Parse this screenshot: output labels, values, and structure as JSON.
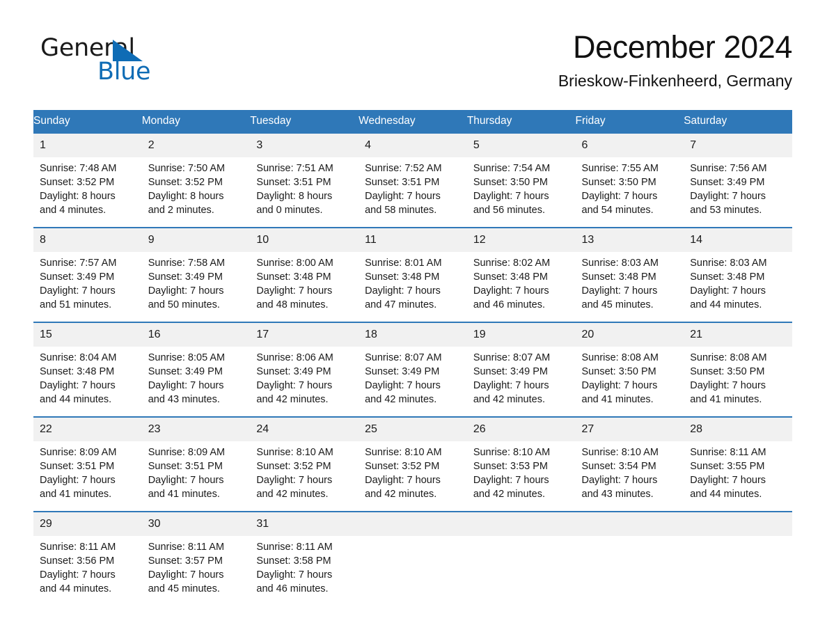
{
  "brand": {
    "word_one": "General",
    "word_two": "Blue",
    "triangle_color": "#0f6cb5"
  },
  "header": {
    "month_title": "December 2024",
    "location": "Brieskow-Finkenheerd, Germany",
    "header_color": "#2f78b8"
  },
  "calendar": {
    "weekday_headers": [
      "Sunday",
      "Monday",
      "Tuesday",
      "Wednesday",
      "Thursday",
      "Friday",
      "Saturday"
    ],
    "weeks": [
      {
        "days": [
          {
            "number": "1",
            "sunrise": "Sunrise: 7:48 AM",
            "sunset": "Sunset: 3:52 PM",
            "daylight_line1": "Daylight: 8 hours",
            "daylight_line2": "and 4 minutes."
          },
          {
            "number": "2",
            "sunrise": "Sunrise: 7:50 AM",
            "sunset": "Sunset: 3:52 PM",
            "daylight_line1": "Daylight: 8 hours",
            "daylight_line2": "and 2 minutes."
          },
          {
            "number": "3",
            "sunrise": "Sunrise: 7:51 AM",
            "sunset": "Sunset: 3:51 PM",
            "daylight_line1": "Daylight: 8 hours",
            "daylight_line2": "and 0 minutes."
          },
          {
            "number": "4",
            "sunrise": "Sunrise: 7:52 AM",
            "sunset": "Sunset: 3:51 PM",
            "daylight_line1": "Daylight: 7 hours",
            "daylight_line2": "and 58 minutes."
          },
          {
            "number": "5",
            "sunrise": "Sunrise: 7:54 AM",
            "sunset": "Sunset: 3:50 PM",
            "daylight_line1": "Daylight: 7 hours",
            "daylight_line2": "and 56 minutes."
          },
          {
            "number": "6",
            "sunrise": "Sunrise: 7:55 AM",
            "sunset": "Sunset: 3:50 PM",
            "daylight_line1": "Daylight: 7 hours",
            "daylight_line2": "and 54 minutes."
          },
          {
            "number": "7",
            "sunrise": "Sunrise: 7:56 AM",
            "sunset": "Sunset: 3:49 PM",
            "daylight_line1": "Daylight: 7 hours",
            "daylight_line2": "and 53 minutes."
          }
        ]
      },
      {
        "days": [
          {
            "number": "8",
            "sunrise": "Sunrise: 7:57 AM",
            "sunset": "Sunset: 3:49 PM",
            "daylight_line1": "Daylight: 7 hours",
            "daylight_line2": "and 51 minutes."
          },
          {
            "number": "9",
            "sunrise": "Sunrise: 7:58 AM",
            "sunset": "Sunset: 3:49 PM",
            "daylight_line1": "Daylight: 7 hours",
            "daylight_line2": "and 50 minutes."
          },
          {
            "number": "10",
            "sunrise": "Sunrise: 8:00 AM",
            "sunset": "Sunset: 3:48 PM",
            "daylight_line1": "Daylight: 7 hours",
            "daylight_line2": "and 48 minutes."
          },
          {
            "number": "11",
            "sunrise": "Sunrise: 8:01 AM",
            "sunset": "Sunset: 3:48 PM",
            "daylight_line1": "Daylight: 7 hours",
            "daylight_line2": "and 47 minutes."
          },
          {
            "number": "12",
            "sunrise": "Sunrise: 8:02 AM",
            "sunset": "Sunset: 3:48 PM",
            "daylight_line1": "Daylight: 7 hours",
            "daylight_line2": "and 46 minutes."
          },
          {
            "number": "13",
            "sunrise": "Sunrise: 8:03 AM",
            "sunset": "Sunset: 3:48 PM",
            "daylight_line1": "Daylight: 7 hours",
            "daylight_line2": "and 45 minutes."
          },
          {
            "number": "14",
            "sunrise": "Sunrise: 8:03 AM",
            "sunset": "Sunset: 3:48 PM",
            "daylight_line1": "Daylight: 7 hours",
            "daylight_line2": "and 44 minutes."
          }
        ]
      },
      {
        "days": [
          {
            "number": "15",
            "sunrise": "Sunrise: 8:04 AM",
            "sunset": "Sunset: 3:48 PM",
            "daylight_line1": "Daylight: 7 hours",
            "daylight_line2": "and 44 minutes."
          },
          {
            "number": "16",
            "sunrise": "Sunrise: 8:05 AM",
            "sunset": "Sunset: 3:49 PM",
            "daylight_line1": "Daylight: 7 hours",
            "daylight_line2": "and 43 minutes."
          },
          {
            "number": "17",
            "sunrise": "Sunrise: 8:06 AM",
            "sunset": "Sunset: 3:49 PM",
            "daylight_line1": "Daylight: 7 hours",
            "daylight_line2": "and 42 minutes."
          },
          {
            "number": "18",
            "sunrise": "Sunrise: 8:07 AM",
            "sunset": "Sunset: 3:49 PM",
            "daylight_line1": "Daylight: 7 hours",
            "daylight_line2": "and 42 minutes."
          },
          {
            "number": "19",
            "sunrise": "Sunrise: 8:07 AM",
            "sunset": "Sunset: 3:49 PM",
            "daylight_line1": "Daylight: 7 hours",
            "daylight_line2": "and 42 minutes."
          },
          {
            "number": "20",
            "sunrise": "Sunrise: 8:08 AM",
            "sunset": "Sunset: 3:50 PM",
            "daylight_line1": "Daylight: 7 hours",
            "daylight_line2": "and 41 minutes."
          },
          {
            "number": "21",
            "sunrise": "Sunrise: 8:08 AM",
            "sunset": "Sunset: 3:50 PM",
            "daylight_line1": "Daylight: 7 hours",
            "daylight_line2": "and 41 minutes."
          }
        ]
      },
      {
        "days": [
          {
            "number": "22",
            "sunrise": "Sunrise: 8:09 AM",
            "sunset": "Sunset: 3:51 PM",
            "daylight_line1": "Daylight: 7 hours",
            "daylight_line2": "and 41 minutes."
          },
          {
            "number": "23",
            "sunrise": "Sunrise: 8:09 AM",
            "sunset": "Sunset: 3:51 PM",
            "daylight_line1": "Daylight: 7 hours",
            "daylight_line2": "and 41 minutes."
          },
          {
            "number": "24",
            "sunrise": "Sunrise: 8:10 AM",
            "sunset": "Sunset: 3:52 PM",
            "daylight_line1": "Daylight: 7 hours",
            "daylight_line2": "and 42 minutes."
          },
          {
            "number": "25",
            "sunrise": "Sunrise: 8:10 AM",
            "sunset": "Sunset: 3:52 PM",
            "daylight_line1": "Daylight: 7 hours",
            "daylight_line2": "and 42 minutes."
          },
          {
            "number": "26",
            "sunrise": "Sunrise: 8:10 AM",
            "sunset": "Sunset: 3:53 PM",
            "daylight_line1": "Daylight: 7 hours",
            "daylight_line2": "and 42 minutes."
          },
          {
            "number": "27",
            "sunrise": "Sunrise: 8:10 AM",
            "sunset": "Sunset: 3:54 PM",
            "daylight_line1": "Daylight: 7 hours",
            "daylight_line2": "and 43 minutes."
          },
          {
            "number": "28",
            "sunrise": "Sunrise: 8:11 AM",
            "sunset": "Sunset: 3:55 PM",
            "daylight_line1": "Daylight: 7 hours",
            "daylight_line2": "and 44 minutes."
          }
        ]
      },
      {
        "days": [
          {
            "number": "29",
            "sunrise": "Sunrise: 8:11 AM",
            "sunset": "Sunset: 3:56 PM",
            "daylight_line1": "Daylight: 7 hours",
            "daylight_line2": "and 44 minutes."
          },
          {
            "number": "30",
            "sunrise": "Sunrise: 8:11 AM",
            "sunset": "Sunset: 3:57 PM",
            "daylight_line1": "Daylight: 7 hours",
            "daylight_line2": "and 45 minutes."
          },
          {
            "number": "31",
            "sunrise": "Sunrise: 8:11 AM",
            "sunset": "Sunset: 3:58 PM",
            "daylight_line1": "Daylight: 7 hours",
            "daylight_line2": "and 46 minutes."
          },
          {
            "number": "",
            "sunrise": "",
            "sunset": "",
            "daylight_line1": "",
            "daylight_line2": ""
          },
          {
            "number": "",
            "sunrise": "",
            "sunset": "",
            "daylight_line1": "",
            "daylight_line2": ""
          },
          {
            "number": "",
            "sunrise": "",
            "sunset": "",
            "daylight_line1": "",
            "daylight_line2": ""
          },
          {
            "number": "",
            "sunrise": "",
            "sunset": "",
            "daylight_line1": "",
            "daylight_line2": ""
          }
        ]
      }
    ]
  }
}
